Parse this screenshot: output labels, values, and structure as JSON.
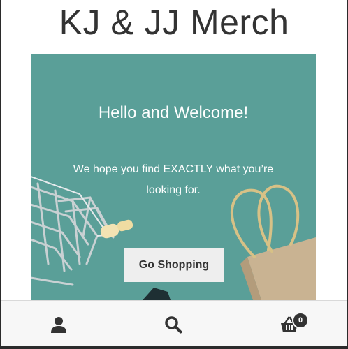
{
  "site": {
    "title": "KJ & JJ Merch"
  },
  "hero": {
    "heading": "Hello and Welcome!",
    "text": "We hope you find EXACTLY what you’re looking for.",
    "button_label": "Go Shopping"
  },
  "footer": {
    "items": [
      {
        "icon": "user-icon"
      },
      {
        "icon": "search-icon"
      },
      {
        "icon": "basket-icon",
        "count": "0"
      }
    ]
  },
  "colors": {
    "hero_background": "#5a9f98",
    "footer_background": "#f7f7f7",
    "button_background": "#eeeeee"
  }
}
